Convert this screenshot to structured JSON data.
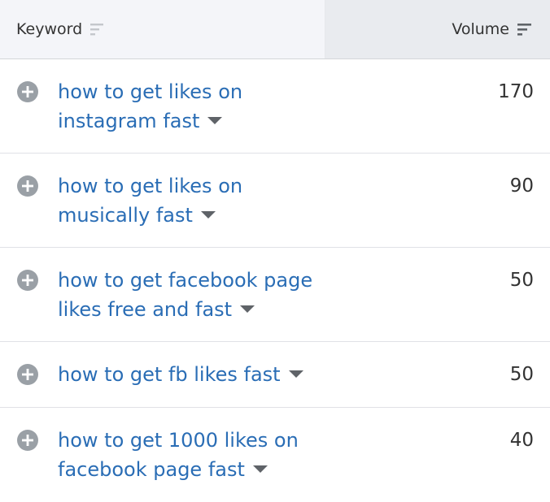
{
  "header": {
    "keyword_label": "Keyword",
    "volume_label": "Volume"
  },
  "rows": [
    {
      "line1": "how to get likes on",
      "line2": "instagram fast",
      "volume": "170"
    },
    {
      "line1": "how to get likes on",
      "line2": "musically fast",
      "volume": "90"
    },
    {
      "line1": "how to get facebook page",
      "line2": "likes free and fast",
      "volume": "50"
    },
    {
      "line1": "how to get fb likes fast",
      "line2": "",
      "volume": "50"
    },
    {
      "line1": "how to get 1000 likes on",
      "line2": "facebook page fast",
      "volume": "40"
    }
  ],
  "icons": {
    "add": "plus-circle-icon",
    "sort": "sort-lines-icon",
    "expand": "caret-down-icon"
  },
  "colors": {
    "link": "#2a6db5",
    "icon_gray": "#9aa0a6",
    "header_bg": "#f4f5f9",
    "header_active_bg": "#e9ebef"
  }
}
